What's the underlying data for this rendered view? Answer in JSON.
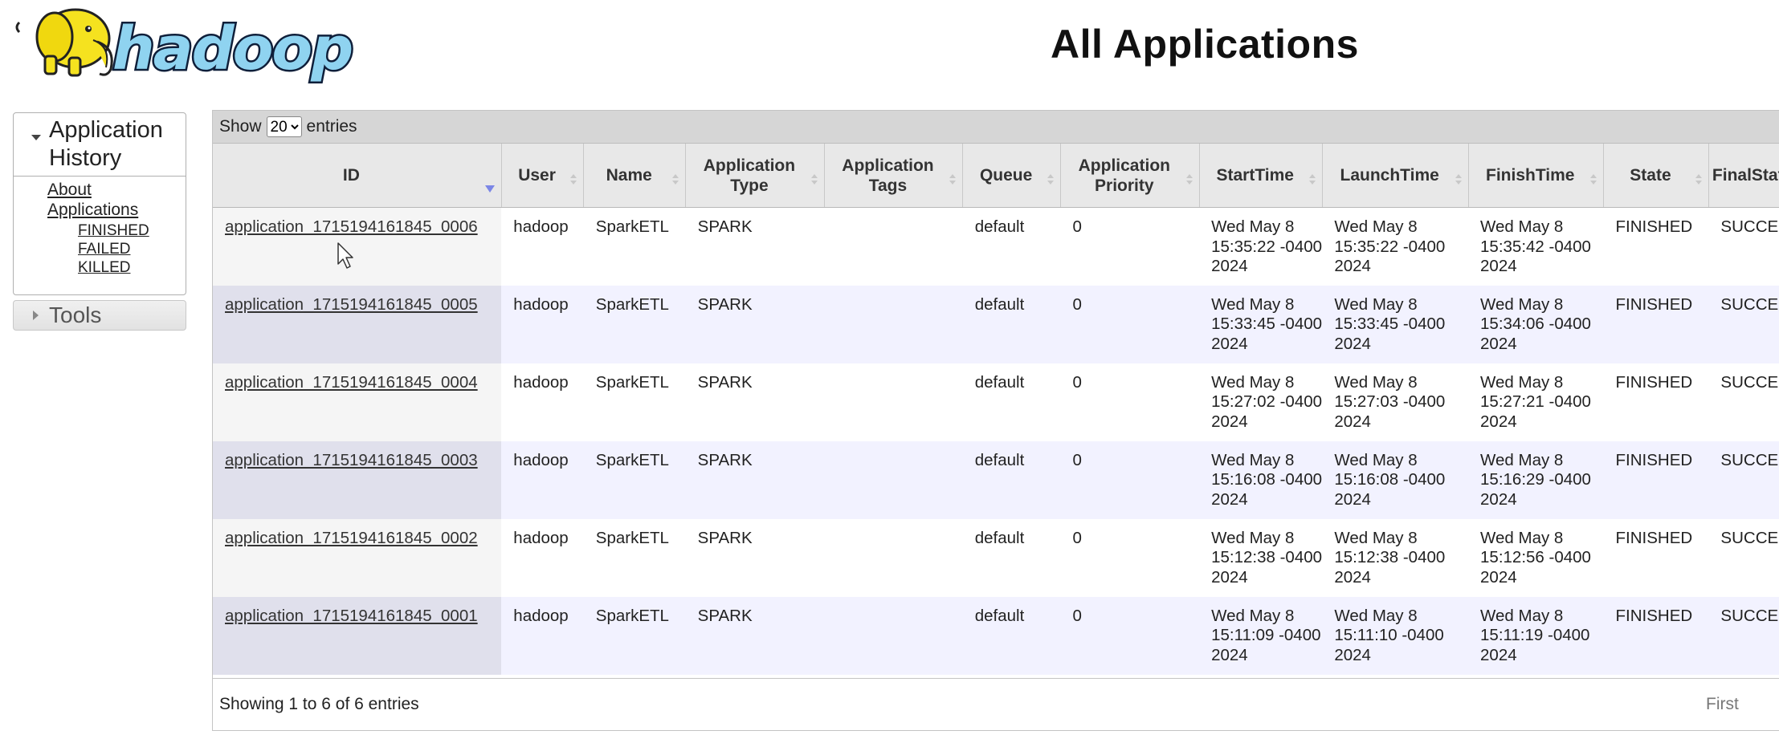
{
  "header": {
    "logo_text": "hadoop",
    "title": "All Applications"
  },
  "sidebar": {
    "section_title": "Application History",
    "about_link": "About",
    "applications_link": "Applications",
    "sub_links": [
      "FINISHED",
      "FAILED",
      "KILLED"
    ],
    "tools_label": "Tools"
  },
  "table": {
    "show_label": "Show",
    "entries_label": "entries",
    "page_size": "20",
    "columns": [
      "ID",
      "User",
      "Name",
      "Application Type",
      "Application Tags",
      "Queue",
      "Application Priority",
      "StartTime",
      "LaunchTime",
      "FinishTime",
      "State",
      "FinalStatus"
    ],
    "sorted_column": "ID",
    "rows": [
      {
        "id": "application_1715194161845_0006",
        "user": "hadoop",
        "name": "SparkETL",
        "type": "SPARK",
        "tags": "",
        "queue": "default",
        "priority": "0",
        "start": "Wed May 8 15:35:22 -0400 2024",
        "launch": "Wed May 8 15:35:22 -0400 2024",
        "finish": "Wed May 8 15:35:42 -0400 2024",
        "state": "FINISHED",
        "final": "SUCCEEDED"
      },
      {
        "id": "application_1715194161845_0005",
        "user": "hadoop",
        "name": "SparkETL",
        "type": "SPARK",
        "tags": "",
        "queue": "default",
        "priority": "0",
        "start": "Wed May 8 15:33:45 -0400 2024",
        "launch": "Wed May 8 15:33:45 -0400 2024",
        "finish": "Wed May 8 15:34:06 -0400 2024",
        "state": "FINISHED",
        "final": "SUCCEEDED"
      },
      {
        "id": "application_1715194161845_0004",
        "user": "hadoop",
        "name": "SparkETL",
        "type": "SPARK",
        "tags": "",
        "queue": "default",
        "priority": "0",
        "start": "Wed May 8 15:27:02 -0400 2024",
        "launch": "Wed May 8 15:27:03 -0400 2024",
        "finish": "Wed May 8 15:27:21 -0400 2024",
        "state": "FINISHED",
        "final": "SUCCEEDED"
      },
      {
        "id": "application_1715194161845_0003",
        "user": "hadoop",
        "name": "SparkETL",
        "type": "SPARK",
        "tags": "",
        "queue": "default",
        "priority": "0",
        "start": "Wed May 8 15:16:08 -0400 2024",
        "launch": "Wed May 8 15:16:08 -0400 2024",
        "finish": "Wed May 8 15:16:29 -0400 2024",
        "state": "FINISHED",
        "final": "SUCCEEDED"
      },
      {
        "id": "application_1715194161845_0002",
        "user": "hadoop",
        "name": "SparkETL",
        "type": "SPARK",
        "tags": "",
        "queue": "default",
        "priority": "0",
        "start": "Wed May 8 15:12:38 -0400 2024",
        "launch": "Wed May 8 15:12:38 -0400 2024",
        "finish": "Wed May 8 15:12:56 -0400 2024",
        "state": "FINISHED",
        "final": "SUCCEEDED"
      },
      {
        "id": "application_1715194161845_0001",
        "user": "hadoop",
        "name": "SparkETL",
        "type": "SPARK",
        "tags": "",
        "queue": "default",
        "priority": "0",
        "start": "Wed May 8 15:11:09 -0400 2024",
        "launch": "Wed May 8 15:11:10 -0400 2024",
        "finish": "Wed May 8 15:11:19 -0400 2024",
        "state": "FINISHED",
        "final": "SUCCEEDED"
      }
    ],
    "info": "Showing 1 to 6 of 6 entries",
    "pager_first": "First"
  },
  "colors": {
    "logo_fill": "#8fd3f0",
    "elephant": "#f5e21f",
    "toolbar_bg": "#d6d6d6",
    "row_alt_bg": "#f2f2ff",
    "sort_arrow": "#7b86e6"
  }
}
